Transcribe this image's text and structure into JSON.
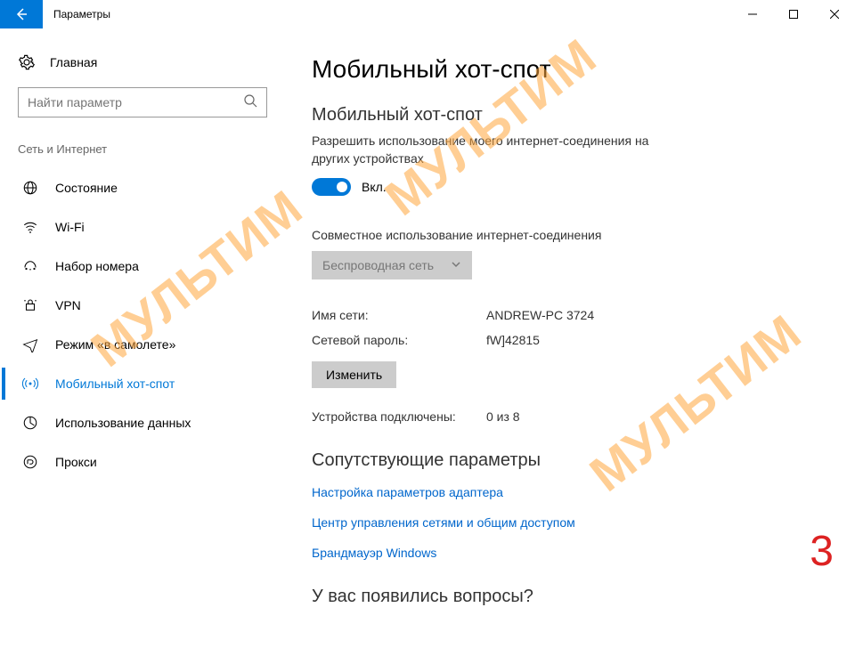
{
  "window": {
    "title": "Параметры"
  },
  "sidebar": {
    "home_label": "Главная",
    "search_placeholder": "Найти параметр",
    "section_title": "Сеть и Интернет",
    "items": [
      {
        "label": "Состояние"
      },
      {
        "label": "Wi-Fi"
      },
      {
        "label": "Набор номера"
      },
      {
        "label": "VPN"
      },
      {
        "label": "Режим «в самолете»"
      },
      {
        "label": "Мобильный хот-спот"
      },
      {
        "label": "Использование данных"
      },
      {
        "label": "Прокси"
      }
    ]
  },
  "main": {
    "page_title": "Мобильный хот-спот",
    "section_title": "Мобильный хот-спот",
    "description": "Разрешить использование моего интернет-соединения на других устройствах",
    "toggle_state": "Вкл.",
    "share_label": "Совместное использование интернет-соединения",
    "dropdown_value": "Беспроводная сеть",
    "network_name_label": "Имя сети:",
    "network_name_value": "ANDREW-PC 3724",
    "password_label": "Сетевой пароль:",
    "password_value": "fW]42815",
    "change_button": "Изменить",
    "devices_label": "Устройства подключены:",
    "devices_value": "0 из 8",
    "related_title": "Сопутствующие параметры",
    "links": [
      "Настройка параметров адаптера",
      "Центр управления сетями и общим доступом",
      "Брандмауэр Windows"
    ],
    "questions_title": "У вас появились вопросы?"
  },
  "watermark": "МУЛЬТИМ",
  "page_number": "3"
}
